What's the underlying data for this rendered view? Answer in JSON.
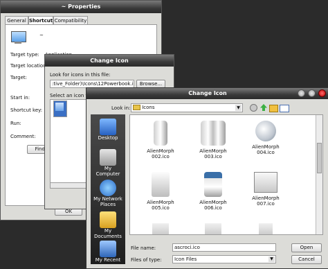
{
  "properties": {
    "title": "~ Properties",
    "tabs": [
      "General",
      "Shortcut",
      "Compatibility"
    ],
    "name": "~",
    "labels": {
      "target_type": "Target type:",
      "target_location": "Target location:",
      "target": "Target:",
      "start_in": "Start in:",
      "shortcut_key": "Shortcut key:",
      "run": "Run:",
      "comment": "Comment:"
    },
    "target_type_value": "Application",
    "find_target": "Find T",
    "ok": "OK"
  },
  "change_icon_small": {
    "title": "Change Icon",
    "look_for": "Look for icons in this file:",
    "path": ":tive_Folder)\\Icons\\12Powerbook.ico",
    "browse": "Browse...",
    "select_icon": "Select an icon fro"
  },
  "change_icon_dialog": {
    "title": "Change Icon",
    "look_in_label": "Look in:",
    "look_in_value": "Icons",
    "places": [
      "Desktop",
      "My Computer",
      "My Network Places",
      "My Documents",
      "My Recent"
    ],
    "files": [
      {
        "name": "AlienMorph 002.ico",
        "icon": "speaker-single-icon"
      },
      {
        "name": "AlienMorph 003.ico",
        "icon": "speakers-pair-icon"
      },
      {
        "name": "AlienMorph 004.ico",
        "icon": "ie-globe-icon"
      },
      {
        "name": "AlienMorph 005.ico",
        "icon": "box-device-icon"
      },
      {
        "name": "AlienMorph 006.ico",
        "icon": "drive-icon"
      },
      {
        "name": "AlienMorph 007.ico",
        "icon": "mail-icon"
      },
      {
        "name": "",
        "icon": "partial-icon-1"
      },
      {
        "name": "",
        "icon": "partial-icon-2"
      },
      {
        "name": "",
        "icon": "partial-icon-3"
      }
    ],
    "file_name_label": "File name:",
    "file_name_value": "ascroci.ico",
    "files_of_type_label": "Files of type:",
    "files_of_type_value": "Icon Files",
    "open": "Open",
    "cancel": "Cancel"
  }
}
